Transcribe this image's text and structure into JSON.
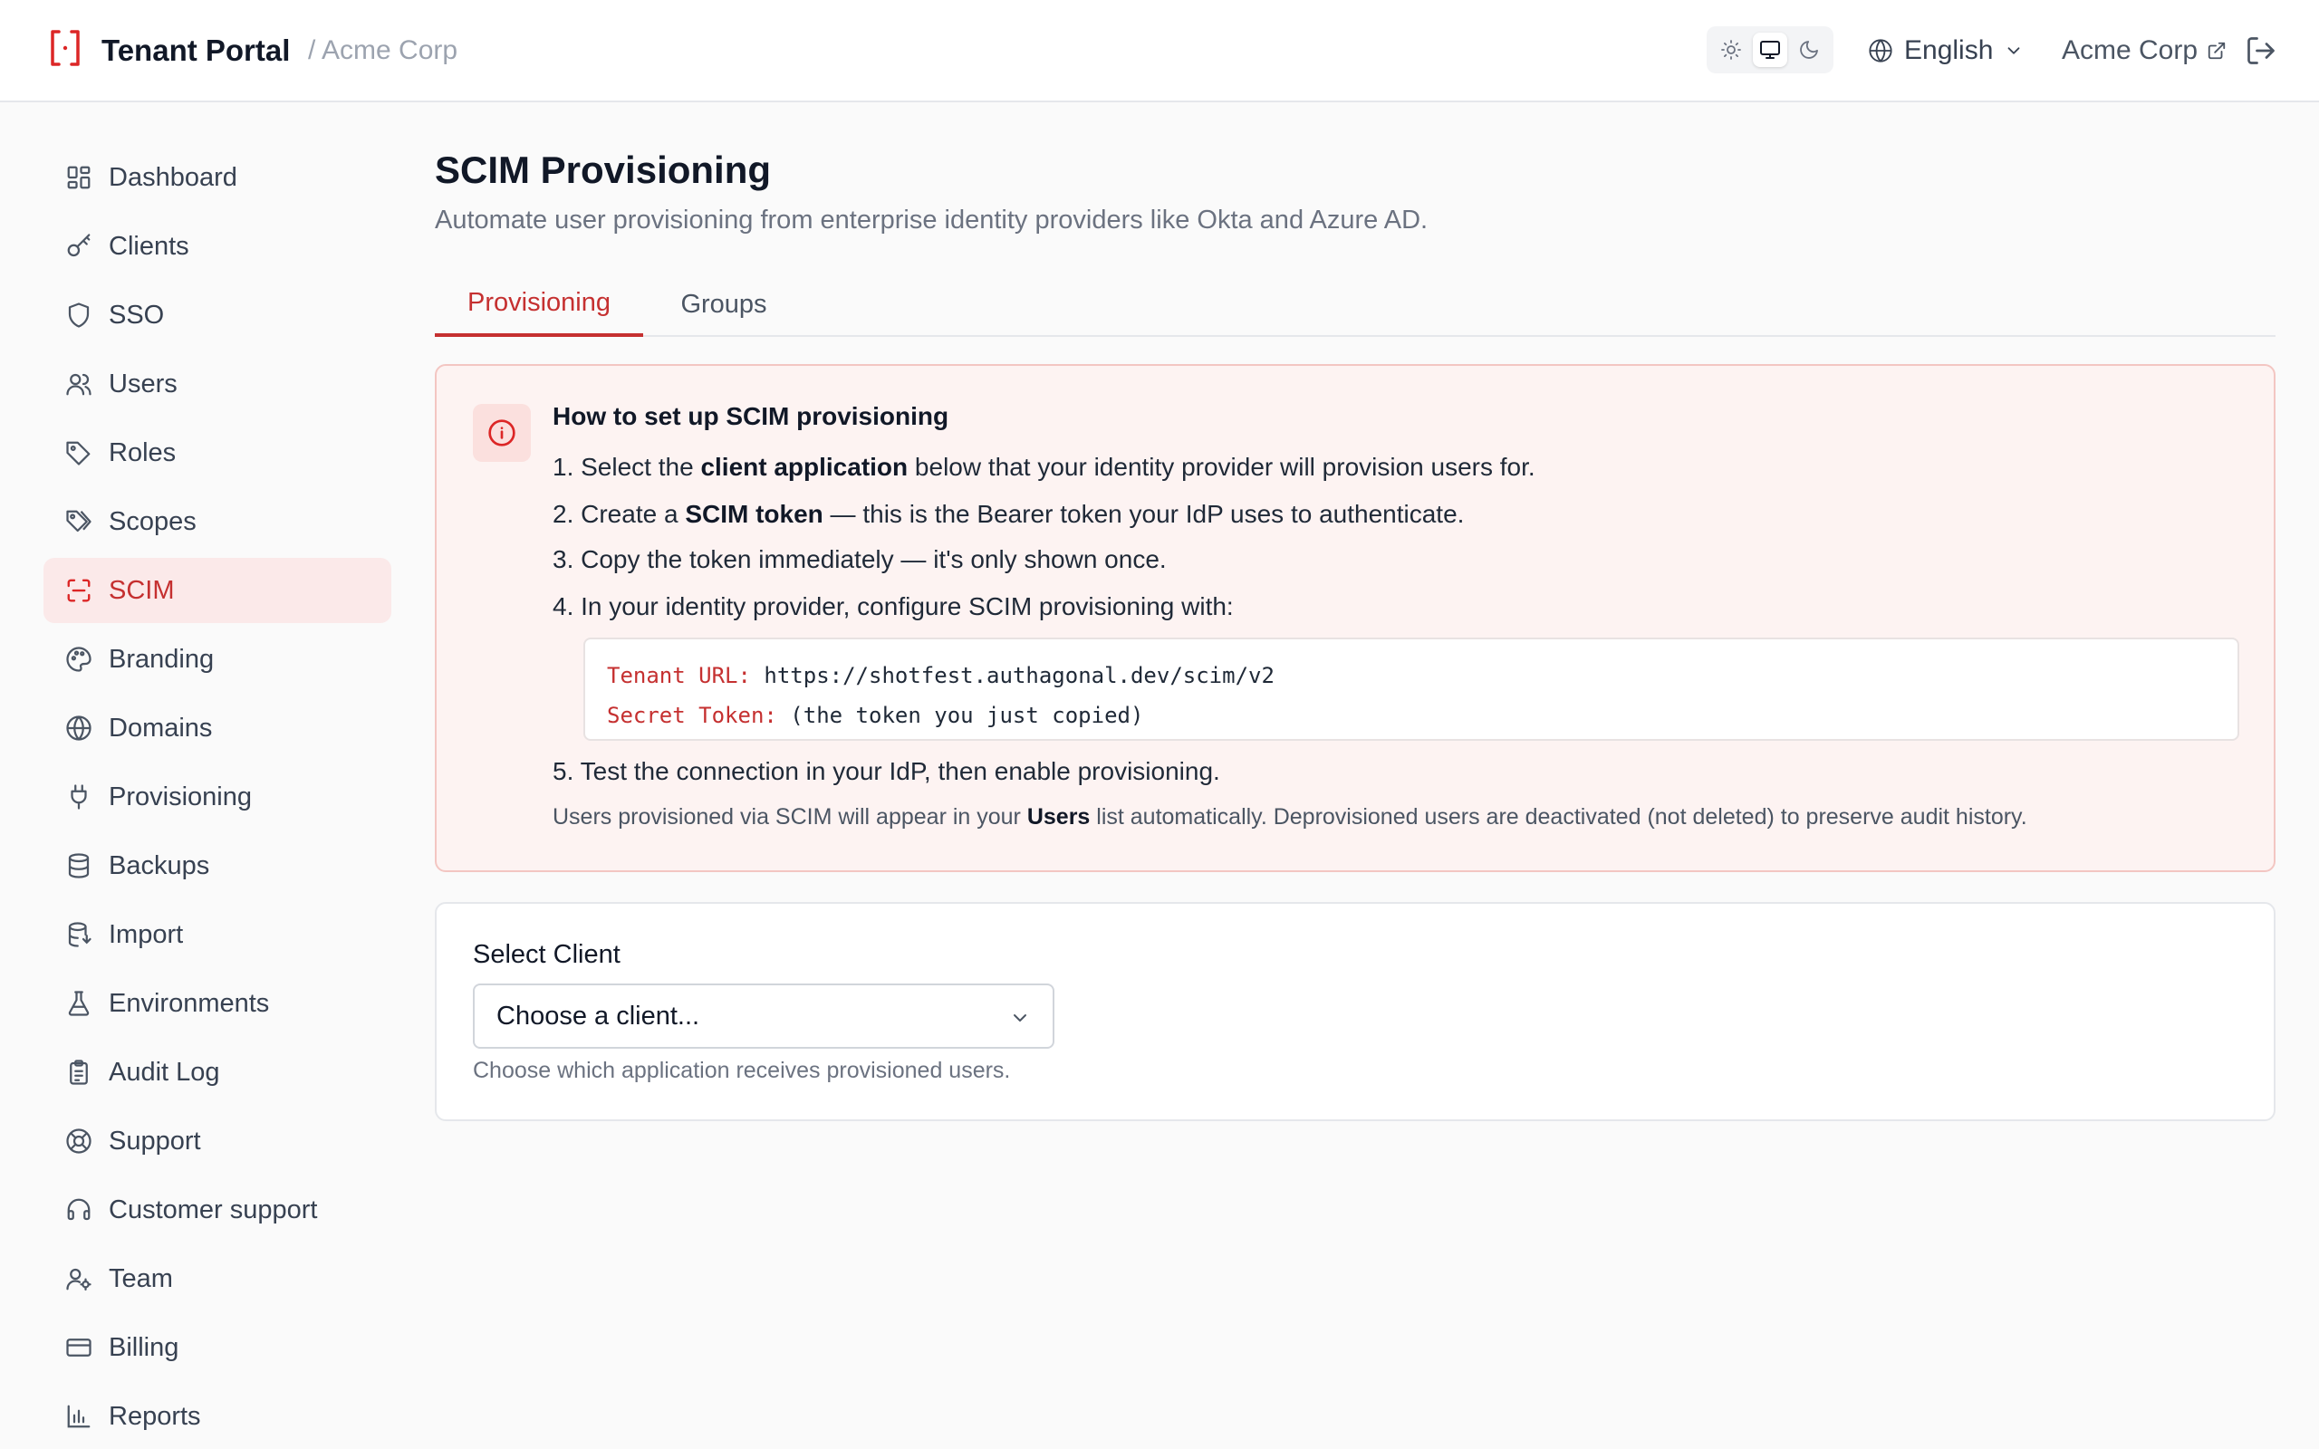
{
  "header": {
    "app_title": "Tenant Portal",
    "tenant_crumb": "/ Acme Corp",
    "theme_options": [
      "light-icon",
      "system-icon",
      "dark-icon"
    ],
    "theme_selected": "system",
    "language": "English",
    "org_link": "Acme Corp"
  },
  "sidebar": {
    "items": [
      {
        "label": "Dashboard",
        "icon": "dashboard-icon"
      },
      {
        "label": "Clients",
        "icon": "key-icon"
      },
      {
        "label": "SSO",
        "icon": "shield-icon"
      },
      {
        "label": "Users",
        "icon": "users-icon"
      },
      {
        "label": "Roles",
        "icon": "tag-icon"
      },
      {
        "label": "Scopes",
        "icon": "tags-icon"
      },
      {
        "label": "SCIM",
        "icon": "scan-icon",
        "active": true
      },
      {
        "label": "Branding",
        "icon": "palette-icon"
      },
      {
        "label": "Domains",
        "icon": "globe-icon"
      },
      {
        "label": "Provisioning",
        "icon": "plug-icon"
      },
      {
        "label": "Backups",
        "icon": "database-icon"
      },
      {
        "label": "Import",
        "icon": "database-import-icon"
      },
      {
        "label": "Environments",
        "icon": "flask-icon"
      },
      {
        "label": "Audit Log",
        "icon": "clipboard-icon"
      },
      {
        "label": "Support",
        "icon": "lifebuoy-icon"
      },
      {
        "label": "Customer support",
        "icon": "headset-icon"
      },
      {
        "label": "Team",
        "icon": "user-cog-icon"
      },
      {
        "label": "Billing",
        "icon": "credit-card-icon"
      },
      {
        "label": "Reports",
        "icon": "bar-chart-icon"
      }
    ]
  },
  "main": {
    "title": "SCIM Provisioning",
    "subtitle": "Automate user provisioning from enterprise identity providers like Okta and Azure AD.",
    "tabs": [
      {
        "label": "Provisioning",
        "active": true
      },
      {
        "label": "Groups",
        "active": false
      }
    ],
    "info": {
      "heading": "How to set up SCIM provisioning",
      "step1_prefix": "1. Select the ",
      "step1_bold": "client application",
      "step1_suffix": " below that your identity provider will provision users for.",
      "step2_prefix": "2. Create a ",
      "step2_bold": "SCIM token",
      "step2_suffix": " — this is the Bearer token your IdP uses to authenticate.",
      "step3": "3. Copy the token immediately — it's only shown once.",
      "step4": "4. In your identity provider, configure SCIM provisioning with:",
      "code_url_key": "Tenant URL:",
      "code_url_value": "https://shotfest.authagonal.dev/scim/v2",
      "code_token_key": "Secret Token:",
      "code_token_value": "(the token you just copied)",
      "step5": "5. Test the connection in your IdP, then enable provisioning.",
      "note_prefix": "Users provisioned via SCIM will appear in your ",
      "note_bold": "Users",
      "note_suffix": " list automatically. Deprovisioned users are deactivated (not deleted) to preserve audit history."
    },
    "client_select": {
      "label": "Select Client",
      "value": "Choose a client...",
      "help": "Choose which application receives provisioned users."
    }
  },
  "colors": {
    "accent": "#c53030",
    "accent_bg": "#fbe9e9",
    "info_bg": "#fdf3f2",
    "info_border": "#f3c6c2"
  }
}
